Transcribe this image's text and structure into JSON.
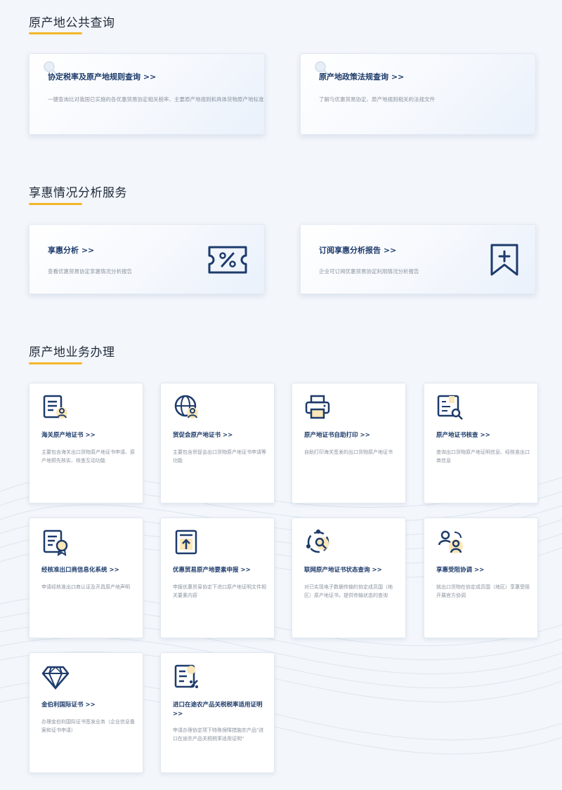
{
  "sections": {
    "public_query": {
      "title": "原产地公共查询"
    },
    "benefit_analysis": {
      "title": "享惠情况分析服务"
    },
    "business": {
      "title": "原产地业务办理"
    }
  },
  "public_query_cards": [
    {
      "title": "协定税率及原产地规则查询 >>",
      "desc": "一键查询比对我国已实施的各优惠贸易协定相关税率、主要原产地规则和具体货物原产地标准"
    },
    {
      "title": "原产地政策法规查询 >>",
      "desc": "了解与优惠贸易协定、原产地规则相关的法规文件"
    }
  ],
  "analysis_cards": [
    {
      "title": "享惠分析 >>",
      "desc": "查看优惠贸易协定享惠情况分析报告",
      "icon": "percent-ticket-icon"
    },
    {
      "title": "订阅享惠分析报告 >>",
      "desc": "企业可订阅优惠贸易协定利用情况分析报告",
      "icon": "bookmark-plus-icon"
    }
  ],
  "business_cards": [
    {
      "title": "海关原产地证书 >>",
      "desc": "主要包含海关出口货物原产地证书申请、原产地预先核实、核查互动功能",
      "icon": "certificate-user-icon"
    },
    {
      "title": "贸促会原产地证书 >>",
      "desc": "主要包含贸促会出口货物原产地证书申请等功能",
      "icon": "globe-user-icon"
    },
    {
      "title": "原产地证书自助打印 >>",
      "desc": "自助打印海关签发的出口货物原产地证书",
      "icon": "printer-icon"
    },
    {
      "title": "原产地证书核查 >>",
      "desc": "查询出口货物原产地证明信息、经核准出口商信息",
      "icon": "document-search-icon"
    },
    {
      "title": "经核准出口商信息化系统 >>",
      "desc": "申请经核准出口商认证及开具原产地声明",
      "icon": "certificate-badge-icon"
    },
    {
      "title": "优惠贸易原产地要素申报 >>",
      "desc": "申报优惠贸易协定下进口原产地证明文件相关要素内容",
      "icon": "upload-document-icon"
    },
    {
      "title": "联网原产地证书状态查询 >>",
      "desc": "对已实现电子数据传输的协定成员国（地区）原产地证书，提供传输状态的查询",
      "icon": "network-search-icon"
    },
    {
      "title": "享惠受阻协调 >>",
      "desc": "就出口货物在协定成员国（地区）享惠受阻开展官方协调",
      "icon": "users-coordinate-icon"
    },
    {
      "title": "金伯利国际证书 >>",
      "desc": "办理金伯利国际证书签发业务（企业信息备案和证书申请）",
      "icon": "diamond-icon"
    },
    {
      "title": "进口在途农产品关税税率适用证明 >>",
      "desc": "申请办理协定项下特殊保障措施农产品\"进口在途农产品关税税率适用证明\"",
      "icon": "document-percent-icon"
    }
  ]
}
